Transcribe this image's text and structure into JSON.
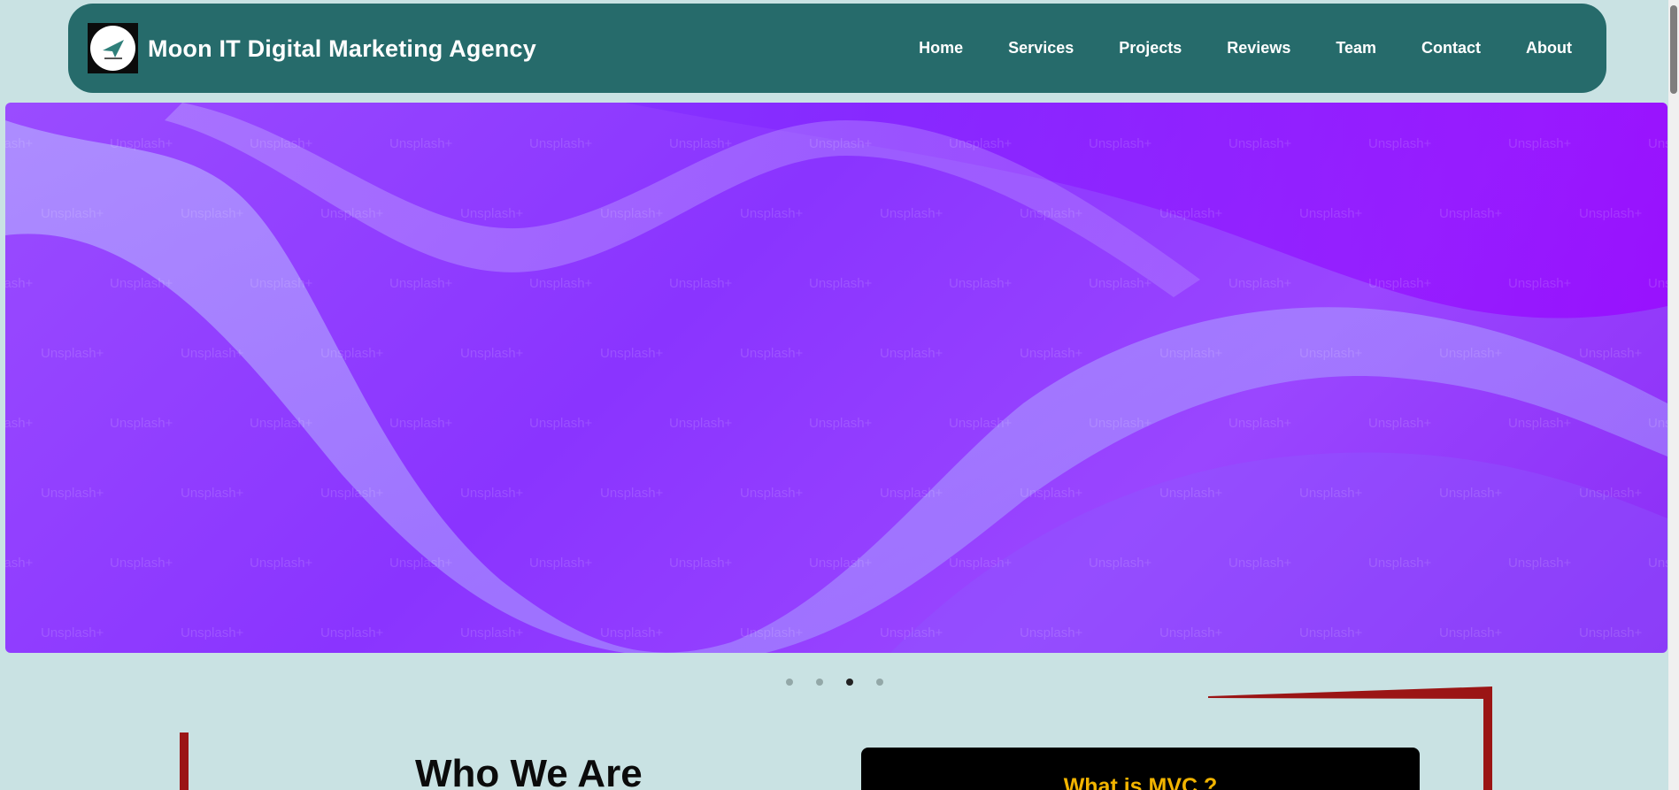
{
  "brand": {
    "name": "Moon IT Digital Marketing Agency",
    "logo_icon": "paper-plane-logo"
  },
  "nav": {
    "links": [
      {
        "label": "Home"
      },
      {
        "label": "Services"
      },
      {
        "label": "Projects"
      },
      {
        "label": "Reviews"
      },
      {
        "label": "Team"
      },
      {
        "label": "Contact"
      },
      {
        "label": "About"
      }
    ]
  },
  "hero": {
    "watermark": "Unsplash+",
    "colors": {
      "base": "#9a4cff",
      "wave": "#a58bff"
    }
  },
  "carousel": {
    "slide_count": 4,
    "active_index": 2
  },
  "about": {
    "title": "Who We Are"
  },
  "mvc_card": {
    "title": "What is MVC ?"
  },
  "colors": {
    "page_bg": "#c9e2e3",
    "navbar_bg": "#266b6b",
    "accent_red": "#9b1515",
    "mvc_title": "#f2b400"
  }
}
